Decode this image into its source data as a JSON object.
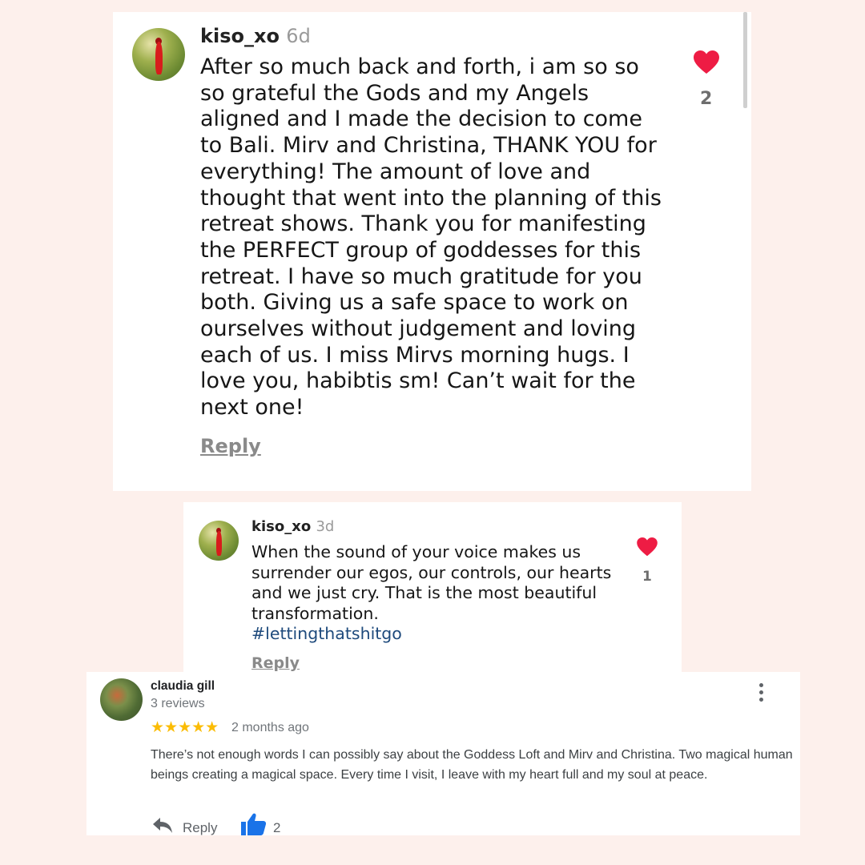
{
  "comments": [
    {
      "username": "kiso_xo",
      "age": "6d",
      "text": "After so much back and forth, i am so so so grateful the Gods and my Angels aligned and I made the decision to come to Bali. Mirv and Christina, THANK YOU for everything! The amount of love and thought that went into the planning of this retreat shows. Thank you for manifesting the PERFECT group of goddesses for this retreat. I have so much gratitude for you both. Giving us a safe space to work on ourselves without judgement and loving each of us. I miss Mirvs morning hugs. I love you, habibtis sm!  Can’t wait for the next one!",
      "reply_label": "Reply",
      "like_count": "2",
      "like_icon": "heart-icon",
      "heart_color": "#ee1c44"
    },
    {
      "username": "kiso_xo",
      "age": "3d",
      "text": "When the sound of your voice makes us surrender our egos, our controls, our hearts and we just cry. That is the most beautiful transformation.",
      "hashtag": "#lettingthatshitgo",
      "reply_label": "Reply",
      "like_count": "1",
      "like_icon": "heart-icon",
      "heart_color": "#ee1c44"
    }
  ],
  "review": {
    "reviewer": "claudia gill",
    "review_count": "3 reviews",
    "rating": 5,
    "stars": "★★★★★",
    "date": "2 months ago",
    "text": "There’s not enough words I can possibly say about the Goddess Loft and Mirv and Christina. Two magical human beings creating a magical space. Every time I visit, I leave with my heart full and my soul at peace.",
    "reply_label": "Reply",
    "helpful_count": "2",
    "star_color": "#fbbc04",
    "thumb_color": "#1a73e8"
  },
  "colors": {
    "background": "#fdf0ec",
    "card": "#ffffff",
    "hashtag": "#1e4a7c"
  }
}
